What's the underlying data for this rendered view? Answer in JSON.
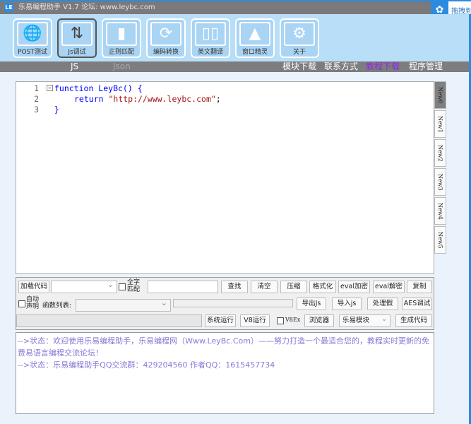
{
  "title": "乐易编程助手 V1.7 论坛: www.leybc.com",
  "logo": "LE",
  "badge": "拖拽到",
  "ribbon": [
    {
      "label": "POST测试",
      "icon": "globe-icon",
      "glyph": "🌐"
    },
    {
      "label": "Js调试",
      "icon": "swap-arrows-icon",
      "glyph": "⇅"
    },
    {
      "label": "正则匹配",
      "icon": "document-icon",
      "glyph": "▮"
    },
    {
      "label": "编码转换",
      "icon": "refresh-icon",
      "glyph": "⟳"
    },
    {
      "label": "英文翻译",
      "icon": "book-icon",
      "glyph": "▯▯"
    },
    {
      "label": "窗口精灵",
      "icon": "screen-icon",
      "glyph": "▲"
    },
    {
      "label": "关于",
      "icon": "gear-icon",
      "glyph": "⚙"
    }
  ],
  "tabs": {
    "js": "JS",
    "json": "Json",
    "module": "模块下载",
    "contact": "联系方式",
    "tutorial": "教程下载",
    "manage": "程序管理"
  },
  "code": {
    "l1": "function LeyBc() {",
    "l2a": "return ",
    "l2b": "\"http://www.leybc.com\"",
    "l2c": ";",
    "l3": "}"
  },
  "sidetabs": [
    "New0",
    "New1",
    "New2",
    "New3",
    "New4",
    "New5"
  ],
  "panel": {
    "load": "加载代码",
    "whole": "全字匹配",
    "find": "查找",
    "clear": "清空",
    "compress": "压缩",
    "format": "格式化",
    "evalenc": "eval加密",
    "evaldec": "eval解密",
    "copy": "复制",
    "auto": "自动声明",
    "funclist": "函数列表:",
    "exportjs": "导出Js",
    "importjs": "导入js",
    "handle": "处理假",
    "aes": "AES调试",
    "sysrun": "系统运行",
    "v8run": "V8运行",
    "v8ex": "V8Ex",
    "browser": "浏览器",
    "module": "乐易模块",
    "gen": "生成代码"
  },
  "log": [
    "-->状态：欢迎使用乐易编程助手，乐易编程网（Www.LeyBc.Com）——努力打造一个最适合您的，教程实时更新的免费易语言编程交流论坛！",
    "-->状态：乐易编程助手QQ交流群：429204560 作者QQ：1615457734"
  ]
}
